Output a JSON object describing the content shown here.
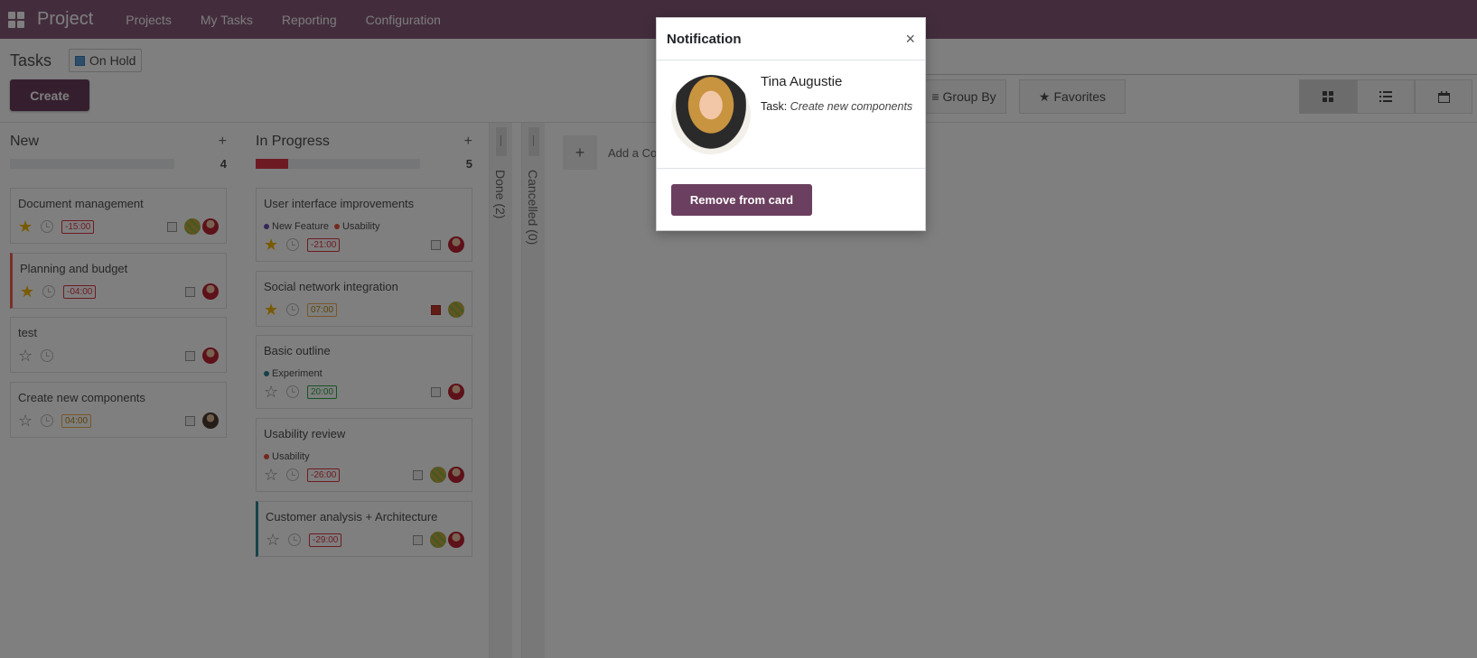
{
  "navbar": {
    "brand": "Project",
    "menu": [
      "Projects",
      "My Tasks",
      "Reporting",
      "Configuration"
    ]
  },
  "control_panel": {
    "title": "Tasks",
    "filter_chip": "On Hold",
    "create_label": "Create",
    "group_by_label": "Group By",
    "favorites_label": "Favorites",
    "views": [
      "kanban-icon",
      "list-icon",
      "calendar-icon"
    ]
  },
  "columns": [
    {
      "title": "New",
      "count": "4",
      "progress": 0,
      "cards": [
        {
          "name": "Document management",
          "starred": true,
          "deadline": "-15:00",
          "deadline_style": "red"
        },
        {
          "name": "Planning and budget",
          "starred": true,
          "deadline": "-04:00",
          "deadline_style": "red"
        },
        {
          "name": "test",
          "starred": false,
          "deadline": "",
          "deadline_style": ""
        },
        {
          "name": "Create new components",
          "starred": false,
          "deadline": "04:00",
          "deadline_style": "orange"
        }
      ]
    },
    {
      "title": "In Progress",
      "count": "5",
      "progress": 0.2,
      "cards": [
        {
          "name": "User interface improvements",
          "tags": [
            "New Feature",
            "Usability"
          ],
          "starred": true,
          "deadline": "-21:00",
          "deadline_style": "red"
        },
        {
          "name": "Social network integration",
          "starred": true,
          "deadline": "07:00",
          "deadline_style": "orange"
        },
        {
          "name": "Basic outline",
          "tags": [
            "Experiment"
          ],
          "starred": false,
          "deadline": "20:00",
          "deadline_style": "green"
        },
        {
          "name": "Usability review",
          "tags": [
            "Usability"
          ],
          "starred": false,
          "deadline": "-26:00",
          "deadline_style": "red"
        },
        {
          "name": "Customer analysis + Architecture",
          "starred": false,
          "deadline": "-29:00",
          "deadline_style": "red"
        }
      ]
    }
  ],
  "folded_columns": [
    "Done (2)",
    "Cancelled (0)"
  ],
  "add_column_label": "Add a Co",
  "modal": {
    "title": "Notification",
    "close": "×",
    "person_name": "Tina Augustie",
    "task_label": "Task:",
    "task_value": "Create new components",
    "remove_label": "Remove from card"
  },
  "colors": {
    "navbar": "#875A7B",
    "primary_button": "#6b3f5f",
    "star": "#f3b400",
    "danger": "#dc3545"
  }
}
